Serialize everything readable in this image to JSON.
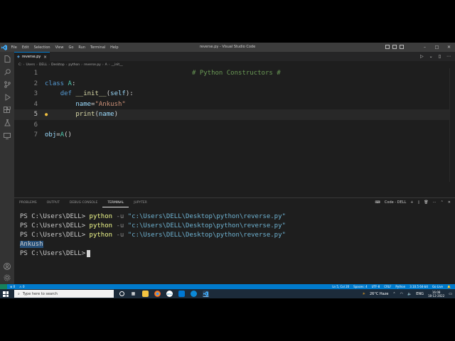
{
  "window": {
    "title": "reverse.py - Visual Studio Code",
    "menu": [
      "File",
      "Edit",
      "Selection",
      "View",
      "Go",
      "Run",
      "Terminal",
      "Help"
    ],
    "controls": {
      "minimize": "–",
      "maximize": "□",
      "close": "✕"
    }
  },
  "tab": {
    "label": "reverse.py",
    "icon": "python-icon",
    "close": "×"
  },
  "breadcrumb": [
    "C:",
    "Users",
    "DELL",
    "Desktop",
    "python",
    "reverse.py",
    "A",
    "__init__"
  ],
  "editor": {
    "lines": [
      {
        "num": "1",
        "text": "# Python Constructors #"
      },
      {
        "num": "2",
        "text": "class A:"
      },
      {
        "num": "3",
        "text": "    def __init__(self):"
      },
      {
        "num": "4",
        "text": "        name=\"Ankush\""
      },
      {
        "num": "5",
        "text": "        print(name)"
      },
      {
        "num": "6",
        "text": ""
      },
      {
        "num": "7",
        "text": "obj=A()"
      }
    ],
    "active_line": "5"
  },
  "panel": {
    "tabs": [
      "PROBLEMS",
      "OUTPUT",
      "DEBUG CONSOLE",
      "TERMINAL",
      "JUPYTER"
    ],
    "active_tab": "TERMINAL",
    "terminal_selector": "Code - DELL",
    "terminal": {
      "prompt": "PS C:\\Users\\DELL>",
      "command": "python",
      "flag": "-u",
      "path": "\"c:\\Users\\DELL\\Desktop\\python\\reverse.py\"",
      "output": "Ankush",
      "run_count": 3
    }
  },
  "statusbar": {
    "left": [
      "⊗ 0",
      "⚠ 0"
    ],
    "right": [
      "Ln 5, Col 20",
      "Spaces: 4",
      "UTF-8",
      "CRLF",
      "Python",
      "3.10.5 64-bit",
      "Go Live"
    ]
  },
  "taskbar": {
    "search_placeholder": "Type here to search",
    "weather": "26°C Haze",
    "language": "ENG",
    "time": "16:08",
    "date": "18-12-2022"
  },
  "colors": {
    "accent": "#007acc",
    "keyword": "#569cd6",
    "string": "#ce9178",
    "function": "#dcdcaa",
    "comment": "#6a9955"
  }
}
